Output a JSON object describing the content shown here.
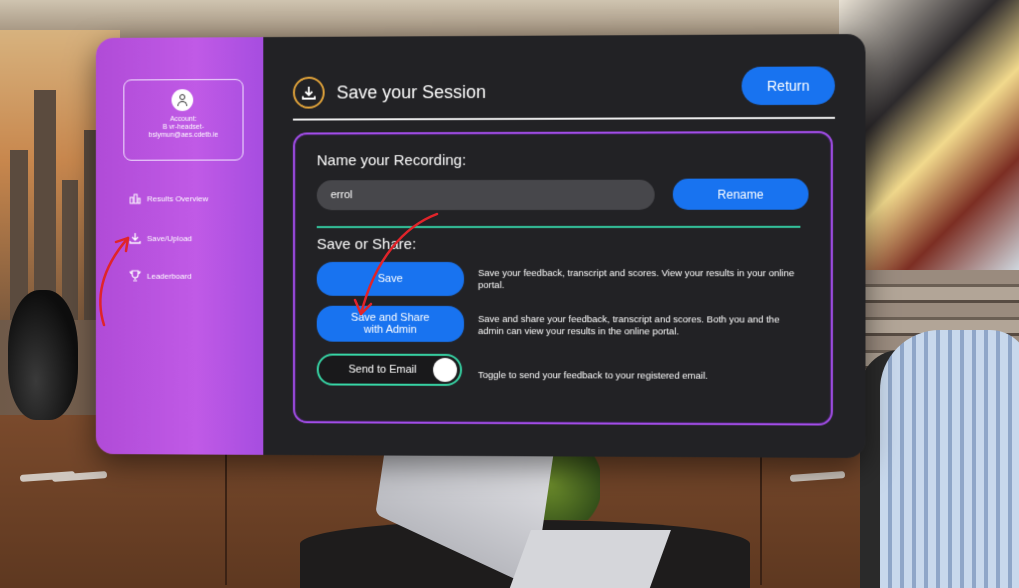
{
  "sidebar": {
    "account": {
      "label": "Account:",
      "line1": "B vr-headset-",
      "line2": "bslymun@aes.cdetb.ie"
    },
    "items": [
      {
        "label": "Results Overview",
        "icon": "bar-chart-icon"
      },
      {
        "label": "Save/Upload",
        "icon": "download-icon"
      },
      {
        "label": "Leaderboard",
        "icon": "trophy-icon"
      }
    ]
  },
  "header": {
    "title": "Save your Session",
    "return_label": "Return"
  },
  "recording": {
    "label": "Name your Recording:",
    "value": "errol",
    "rename_label": "Rename"
  },
  "share": {
    "label": "Save or Share:",
    "save_label": "Save",
    "save_desc": "Save your feedback, transcript and scores. View your results in your online portal.",
    "share_label_1": "Save and Share",
    "share_label_2": "with Admin",
    "share_desc": "Save and share your feedback, transcript and scores. Both you and the admin can view your results in the online portal.",
    "email_label": "Send to Email",
    "email_desc": "Toggle to send your feedback to your registered email."
  },
  "colors": {
    "sidebar": "#b04bd7",
    "panel": "#222225",
    "primary_button": "#1873f0",
    "accent_green": "#34c9a0",
    "annotation_arrow": "#e0242a"
  }
}
